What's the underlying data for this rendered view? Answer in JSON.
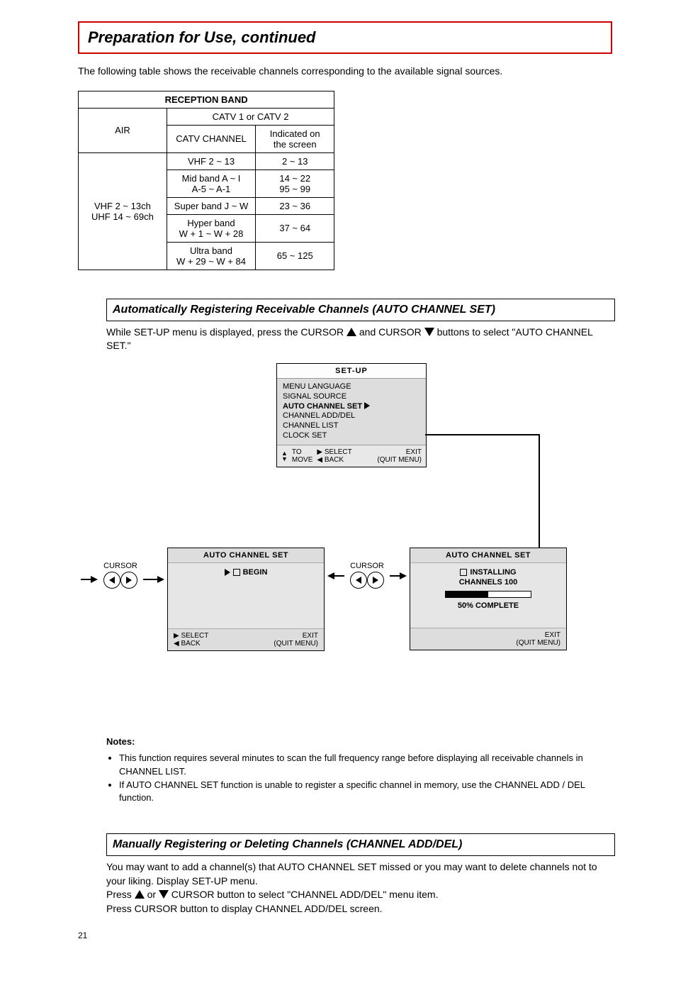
{
  "title": "Preparation for Use, continued",
  "intro": "The following table shows the receivable channels corresponding to the available signal sources.",
  "table": {
    "header": "RECEPTION BAND",
    "sub": "CATV 1 or CATV 2",
    "col_air": "AIR",
    "col_catv": "CATV CHANNEL",
    "col_ind": "Indicated on the screen",
    "air_val_1": "VHF  2 ~ 13ch",
    "air_val_2": "UHF 14 ~ 69ch",
    "rows": [
      {
        "catv": "VHF 2 ~ 13",
        "ind": "2 ~ 13"
      },
      {
        "catv": "Mid band A ~ I\nA-5 ~ A-1",
        "ind": "14 ~ 22\n95 ~ 99"
      },
      {
        "catv": "Super band J ~ W",
        "ind": "23 ~ 36"
      },
      {
        "catv": "Hyper band\nW + 1 ~ W + 28",
        "ind": "37 ~ 64"
      },
      {
        "catv": "Ultra band\nW + 29 ~ W + 84",
        "ind": "65 ~ 125"
      }
    ]
  },
  "sec_auto": {
    "heading": "Automatically Registering Receivable Channels (AUTO CHANNEL SET)",
    "text_pre": "While SET-UP menu is displayed, press the CURSOR ",
    "text_mid": " and CURSOR ",
    "text_post": " buttons to select \"AUTO CHANNEL SET.\""
  },
  "osd_setup": {
    "title": "SET-UP",
    "items": [
      "MENU LANGUAGE",
      "SIGNAL SOURCE",
      "AUTO CHANNEL SET",
      "CHANNEL ADD/DEL",
      "CHANNEL LIST",
      "CLOCK SET"
    ],
    "foot_move": "TO\nMOVE",
    "foot_sel": "SELECT",
    "foot_back": "BACK",
    "foot_exit": "EXIT",
    "foot_quit": "(QUIT MENU)"
  },
  "cursor_label": "CURSOR",
  "osd_begin": {
    "title": "AUTO CHANNEL SET",
    "begin": "BEGIN",
    "foot_sel": "SELECT",
    "foot_back": "BACK",
    "foot_exit": "EXIT",
    "foot_quit": "(QUIT MENU)"
  },
  "osd_install": {
    "title": "AUTO CHANNEL SET",
    "installing": "INSTALLING",
    "channels": "CHANNELS 100",
    "complete": "50% COMPLETE",
    "foot_exit": "EXIT",
    "foot_quit": "(QUIT MENU)"
  },
  "notes": {
    "heading": "Notes:",
    "n1": "This function requires several minutes to scan the full frequency range before displaying all receivable channels in CHANNEL LIST.",
    "n2": "If AUTO CHANNEL SET function is unable to register a specific channel in memory, use the CHANNEL ADD / DEL function."
  },
  "sec_add": {
    "heading": "Manually Registering or Deleting Channels (CHANNEL ADD/DEL)",
    "l1": "You may want to add a channel(s) that AUTO CHANNEL SET missed or you may want to delete channels not to your liking. Display SET-UP menu.",
    "l2_pre": "Press ",
    "l2_mid": " or ",
    "l2_post": " CURSOR button to select \"CHANNEL ADD/DEL\" menu item.",
    "l3": "Press CURSOR button to display CHANNEL ADD/DEL screen."
  },
  "page_number": "21"
}
